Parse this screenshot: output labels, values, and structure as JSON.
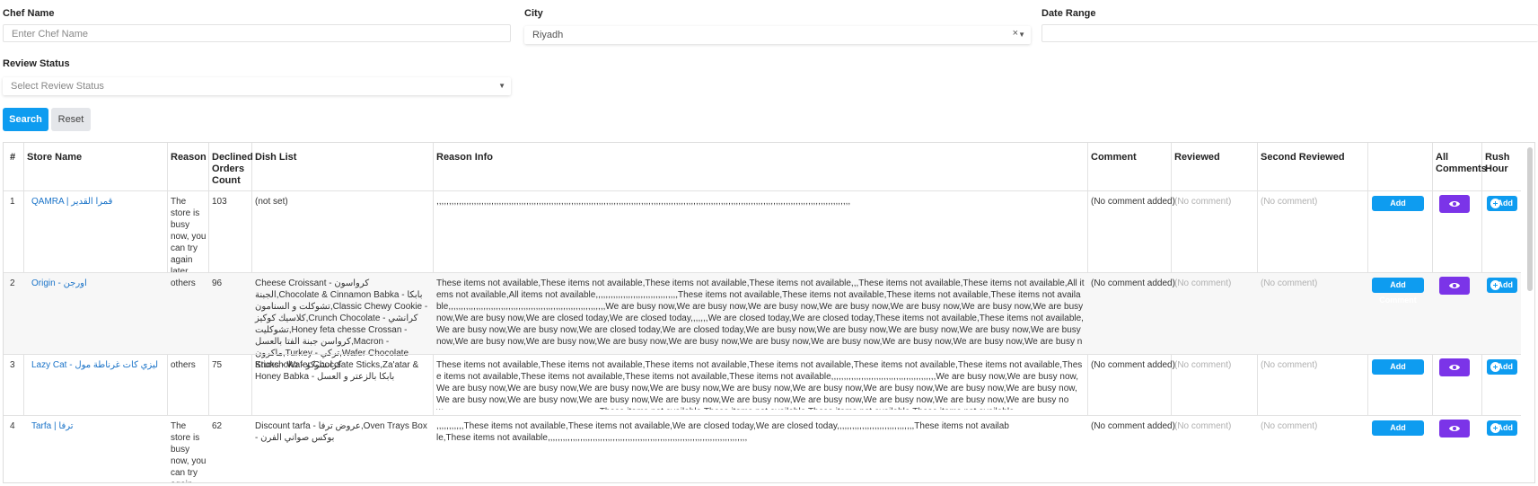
{
  "filters": {
    "chef_name_label": "Chef Name",
    "chef_name_placeholder": "Enter Chef Name",
    "city_label": "City",
    "city_value": "Riyadh",
    "date_range_label": "Date Range",
    "review_status_label": "Review Status",
    "review_status_placeholder": "Select Review Status",
    "search_label": "Search",
    "reset_label": "Reset"
  },
  "table": {
    "headers": {
      "num": "#",
      "store": "Store Name",
      "reason": "Reason",
      "declined": "Declined Orders Count",
      "dish": "Dish List",
      "reason_info": "Reason Info",
      "comment": "Comment",
      "reviewed": "Reviewed",
      "second_reviewed": "Second Reviewed",
      "all_comments": "All Comments",
      "rush_hour": "Rush Hour"
    },
    "add_comment_label": "Add Comment",
    "add_label": "Add",
    "rows": [
      {
        "num": "1",
        "store": "QAMRA | قمرا القدير",
        "reason": "The store is busy now, you can try again later",
        "declined": "103",
        "dish": "(not set)",
        "reason_info": ",,,,,,,,,,,,,,,,,,,,,,,,,,,,,,,,,,,,,,,,,,,,,,,,,,,,,,,,,,,,,,,,,,,,,,,,,,,,,,,,,,,,,,,,,,,,,,,,,,,,,,,,,,,,,,,,,,,,,,,,,,,,,,,,,,,,,,,,,,,,,,,,,,,,,,,,,,,,,,,,,,,,,,",
        "comment": "(No comment added)",
        "reviewed": "(No comment)",
        "second_reviewed": "(No comment)"
      },
      {
        "num": "2",
        "store": "Origin - اورجن",
        "reason": "others",
        "declined": "96",
        "dish": "Cheese Croissant - كرواسون الجبنة,Chocolate & Cinnamon Babka - بابكا تشوكلت و السنامون,Classic Chewy Cookie - كلاسيك كوكيز,Crunch Chocolate - كرانشي تشوكليت,Honey feta chesse Crossan - كرواسن جبنة الفتا بالعسل,Macron - ماكرون,Turkey - تركي,Wafer Chocolate Sticks - Wafer Chocolate Sticks,Za'atar & Honey Babka - بابكا بالزعتر و العسل",
        "reason_info": "These items not available,These items not available,These items not available,These items not available,,,These items not available,These items not available,All items not available,All items not available,,,,,,,,,,,,,,,,,,,,,,,,,,,,,,,,,These items not available,These items not available,These items not available,These items not available,,,,,,,,,,,,,,,,,,,,,,,,,,,,,,,,,,,,,,,,,,,,,,,,,,,,,,,,,,,,,,,We are busy now,We are busy now,We are busy now,We are busy now,We are busy now,We are busy now,We are busy now,We are busy now,We are closed today,We are closed today,,,,,,,We are closed today,We are closed today,These items not available,These items not available,We are busy now,We are busy now,We are closed today,We are closed today,We are busy now,We are busy now,We are busy now,We are busy now,We are busy now,We are busy now,We are busy now,We are busy now,We are busy now,We are busy now,We are busy now,We are busy now,We are busy now,We are busy now,We are busy now,We are busy now,We are busy now,We are busy now,We a",
        "comment": "(No comment added)",
        "reviewed": "(No comment)",
        "second_reviewed": "(No comment)"
      },
      {
        "num": "3",
        "store": "Lazy Cat - ليزي كات غرناطة مول",
        "reason": "others",
        "declined": "75",
        "dish": "Krunchoko - كرانشوكو",
        "reason_info": "These items not available,These items not available,These items not available,These items not available,These items not available,These items not available,These items not available,These items not available,These items not available,These items not available,,,,,,,,,,,,,,,,,,,,,,,,,,,,,,,,,,,,,,,,,,We are busy now,We are busy now,We are busy now,We are busy now,We are busy now,We are busy now,We are busy now,We are busy now,We are busy now,We are busy now,We are busy now,We are busy now,We are busy now,We are busy now,We are busy now,We are busy now,We are busy now,We are busy now,We are busy now,We are busy now,,,,,,,,,,,,,,,,,,,,,,,,,,,,,,,,,,,,,,,,,,,,,,,,,,,,,,,,,,,,,,,These items not available,These items not available,These items not available,These items not available",
        "comment": "(No comment added)",
        "reviewed": "(No comment)",
        "second_reviewed": "(No comment)"
      },
      {
        "num": "4",
        "store": "Tarfa | ترفا",
        "reason": "The store is busy now, you can try again",
        "declined": "62",
        "dish": "Discount tarfa - عروض ترفا,Oven Trays Box - بوكس صواني الفرن",
        "reason_info": ",,,,,,,,,,,These items not available,These items not available,We are closed today,We are closed today,,,,,,,,,,,,,,,,,,,,,,,,,,,,,,,These items not available,These items not available,,,,,,,,,,,,,,,,,,,,,,,,,,,,,,,,,,,,,,,,,,,,,,,,,,,,,,,,,,,,,,,,,,,,,,,,,,,,,,,,",
        "comment": "(No comment added)",
        "reviewed": "(No comment)",
        "second_reviewed": "(No comment)"
      }
    ]
  },
  "colors": {
    "primary": "#0e9cf0",
    "purple": "#7b34e8",
    "link": "#1a73c8"
  }
}
